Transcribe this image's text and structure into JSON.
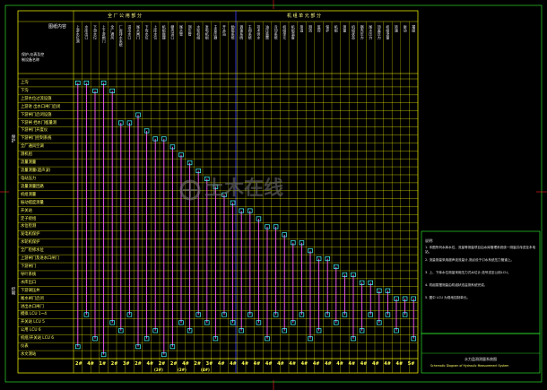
{
  "corner_label": "图纸内容",
  "corner_sub1": "保护,仪表及控",
  "corner_sub2": "制设备名称",
  "section_left_title": "全 厂 公 用 部 分",
  "section_right_title": "机 组 单 元 部 分",
  "left_sidebar_label_1": "保护",
  "left_sidebar_label_2": "控制",
  "row_labels": [
    "上沟",
    "下沟",
    "上游水位过流设施",
    "上游进 出水口闸门启闭",
    "下游闸门启闭设施",
    "下游闸 挡水门槛量测",
    "下游闸门开度仪",
    "下游闸门控制系统",
    "全厂通风空调",
    "测机组",
    "流量测量",
    "流量测量(超声波)",
    "电站压力",
    "流量测量回路",
    "机组测量",
    "振动摆度测量",
    "开关站",
    "定子绕组",
    "水位检测",
    "发电机保护",
    "水轮机保护",
    "全厂检修水位",
    "上游闸门及进水口闸门",
    "下游闸门",
    "导叶系统",
    "水库出口",
    "下游调压井",
    "尾水闸门启闭",
    "进出水口闸门",
    "模拟 LCU 1~4",
    "开关站 LCU 5",
    "公用 LCU 6",
    "机组/开关站 LCU 6",
    "仪表",
    "水文测站"
  ],
  "col_headers": [
    "上游水位测",
    "水库出口",
    "下游水位",
    "上下游闸门",
    "全厂通风",
    "厂房排水系统",
    "进出水口",
    "尾水闸门",
    "下库水位",
    "上库水位",
    "机组振摆",
    "蜗壳进口",
    "尾水管",
    "测压管",
    "水轮机组",
    "发电机组",
    "主变压器",
    "开关站",
    "励磁系统",
    "调速系统",
    "主阀系统",
    "技术供水",
    "油压装置",
    "冷却系统",
    "机组单元",
    "机组温度",
    "测温",
    "测流",
    "监控",
    "保护",
    "机组",
    "测量",
    "机组状态",
    "蜗壳压力",
    "尾水压力",
    "顶盖压力",
    "机组流量",
    "转速",
    "振动",
    "摆度"
  ],
  "bottom_values": [
    "2#",
    "4#",
    "1#",
    "2#",
    "3#",
    "2#",
    "4#",
    "2#",
    "2#",
    "4#",
    "2#",
    "3#",
    "4#",
    "4#",
    "4#",
    "4#",
    "4#",
    "4#",
    "4#",
    "4#",
    "4#",
    "4#",
    "4#",
    "4#",
    "4#",
    "4#",
    "4#",
    "4#",
    "5#"
  ],
  "bottom_sub": [
    "(2#)",
    "(2#)",
    "(4#)"
  ],
  "notes_title": "说明:",
  "notes": [
    "1. 本图所列水库水位、流量等测量项目由水库管理系统统一测量并传送至本电站。",
    "2. 流量测量采用超声波流量计,测点设于引水系统压力管道上。",
    "3. 上、下库水位测量采用压力式水位计,信号送至公用LCU。",
    "4. 机组振摆测量由机组状态监测系统完成。",
    "5. 图中 LCU 为现地控制单元。"
  ],
  "watermark": "土木在线",
  "title_block_cn": "水力监测测量系统图",
  "title_block_en": "Schematic Diagram of Hydraulic Measurement System",
  "colors": {
    "background": "#000000",
    "grid_yellow": "#ffff00",
    "vertical_magenta": "#ff5cff",
    "node_cyan": "#44ffff",
    "border_blue": "#4444ff",
    "frame_green": "#33ff33",
    "frame_red": "#ff2222",
    "watermark": "#6b6b6b"
  }
}
